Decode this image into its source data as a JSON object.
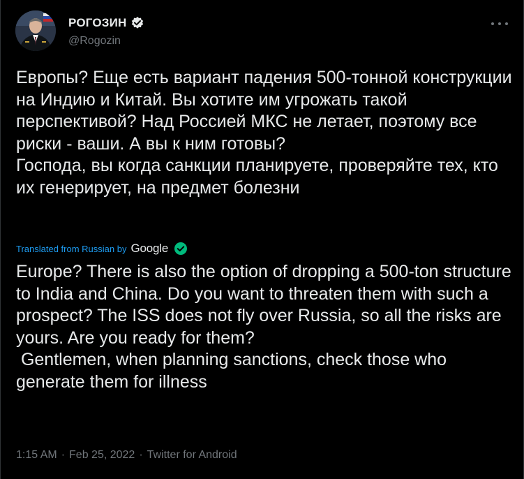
{
  "author": {
    "display_name": "РОГОЗИН",
    "handle": "@Rogozin",
    "verified_icon": "verified-badge-icon",
    "avatar_icon": "profile-photo"
  },
  "more_icon": "more-options-icon",
  "tweet": {
    "original_text": "Европы? Еще есть вариант падения 500-тонной конструкции на Индию и Китай. Вы хотите им угрожать такой перспективой? Над Россией МКС не летает, поэтому все риски - ваши. А вы к ним готовы?\nГоспода, вы когда санкции планируете, проверяйте тех, кто их генерирует, на предмет болезни",
    "translation_label": "Translated from Russian by",
    "translation_provider": "Google",
    "translated_text": "Europe? There is also the option of dropping a 500-ton structure to India and China. Do you want to threaten them with such a prospect? The ISS does not fly over Russia, so all the risks are yours. Are you ready for them?\n Gentlemen, when planning sanctions, check those who generate them for illness"
  },
  "meta": {
    "time": "1:15 AM",
    "separator": "·",
    "date": "Feb 25, 2022",
    "source": "Twitter for Android"
  },
  "colors": {
    "background": "#000000",
    "text": "#e7e9ea",
    "secondary": "#71767b",
    "link": "#1d9bf0",
    "check_green": "#00ba7c"
  }
}
